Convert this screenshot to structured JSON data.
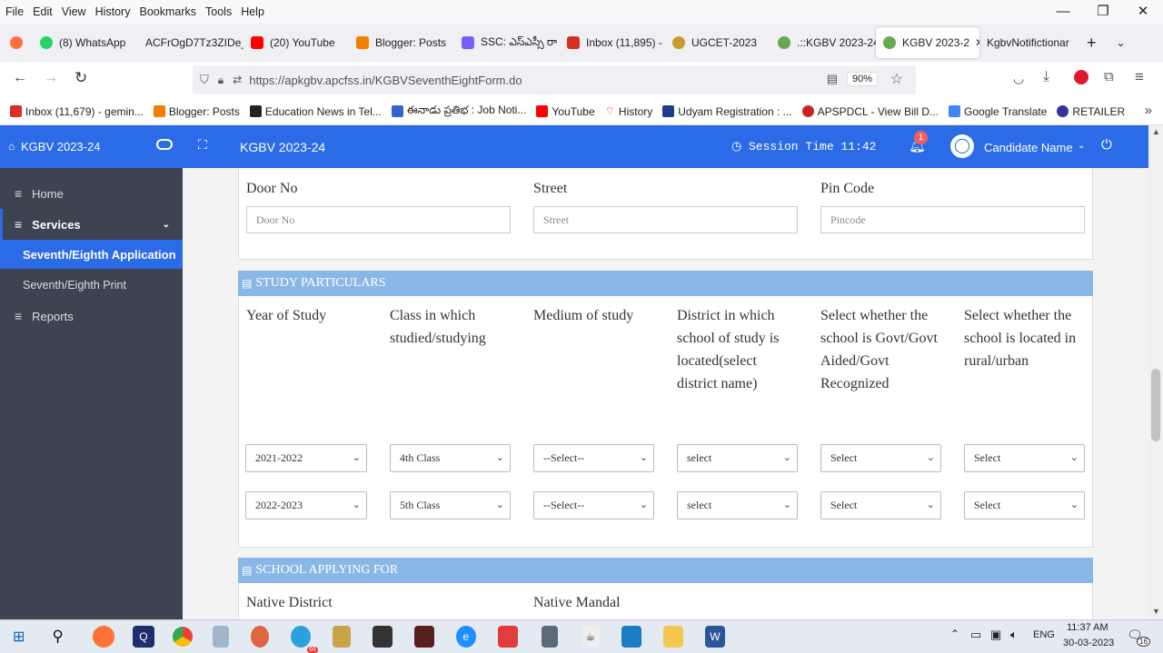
{
  "menubar": {
    "items": [
      "File",
      "Edit",
      "View",
      "History",
      "Bookmarks",
      "Tools",
      "Help"
    ]
  },
  "tabs": [
    {
      "label": "",
      "color": "#ff7139"
    },
    {
      "label": "(8) WhatsApp",
      "color": "#25d366"
    },
    {
      "label": "ACFrOgD7Tz3ZIDe_",
      "color": "#ffffff"
    },
    {
      "label": "(20) YouTube",
      "color": "#ff0000"
    },
    {
      "label": "Blogger: Posts",
      "color": "#f57d00"
    },
    {
      "label": "SSC: ఎస్ఎస్సీ రా",
      "color": "#7a5cff"
    },
    {
      "label": "Inbox (11,895) -",
      "color": "#d93025"
    },
    {
      "label": "UGCET-2023",
      "color": "#c89b2a"
    },
    {
      "label": ".::KGBV 2023-24",
      "color": "#6aa84f"
    },
    {
      "label": "KGBV 2023-2",
      "color": "#6aa84f",
      "active": true
    },
    {
      "label": "KgbvNotifictionar",
      "color": "#ffffff"
    }
  ],
  "nav": {
    "url": "https://apkgbv.apcfss.in/KGBVSeventhEightForm.do",
    "zoom": "90%"
  },
  "bookmarks": [
    {
      "label": "Inbox (11,679) - gemin...",
      "color": "#d93025"
    },
    {
      "label": "Blogger: Posts",
      "color": "#f57d00"
    },
    {
      "label": "Education News in Tel...",
      "color": "#222222"
    },
    {
      "label": "ఈనాడు ప్రతిభ : Job Noti...",
      "color": "#3366cc"
    },
    {
      "label": "YouTube",
      "color": "#ff0000"
    },
    {
      "label": "History",
      "color": "#e33"
    },
    {
      "label": "Udyam Registration : ...",
      "color": "#1d3c8c"
    },
    {
      "label": "APSPDCL - View Bill D...",
      "color": "#cc2222"
    },
    {
      "label": "Google Translate",
      "color": "#4285f4"
    },
    {
      "label": "RETAILER",
      "color": "#333399"
    }
  ],
  "app": {
    "brand": "KGBV 2023-24",
    "title": "KGBV 2023-24",
    "session": "Session Time 11:42",
    "notif_count": "1",
    "user": "Candidate Name",
    "accent": "#2c6be8"
  },
  "sidebar": {
    "home": "Home",
    "services": "Services",
    "seventh_app": "Seventh/Eighth Application",
    "seventh_print": "Seventh/Eighth Print",
    "reports": "Reports"
  },
  "address": {
    "door_label": "Door No",
    "door_placeholder": "Door No",
    "street_label": "Street",
    "street_placeholder": "Street",
    "pin_label": "Pin Code",
    "pin_placeholder": "Pincode"
  },
  "study": {
    "header": "STUDY PARTICULARS",
    "columns": [
      "Year of Study",
      "Class in which studied/studying",
      "Medium of study",
      "District in which school of study is located(select district name)",
      "Select whether the school is Govt/Govt Aided/Govt Recognized",
      "Select whether the school is located in rural/urban"
    ],
    "rows": [
      [
        "2021-2022",
        "4th Class",
        "--Select--",
        "select",
        "Select",
        "Select"
      ],
      [
        "2022-2023",
        "5th Class",
        "--Select--",
        "select",
        "Select",
        "Select"
      ]
    ]
  },
  "school": {
    "header": "SCHOOL APPLYING FOR",
    "native_district": "Native District",
    "native_mandal": "Native Mandal"
  },
  "taskbar": {
    "lang": "ENG",
    "time": "11:37 AM",
    "date": "30-03-2023",
    "notif": "16",
    "badge_telegram": "66"
  }
}
